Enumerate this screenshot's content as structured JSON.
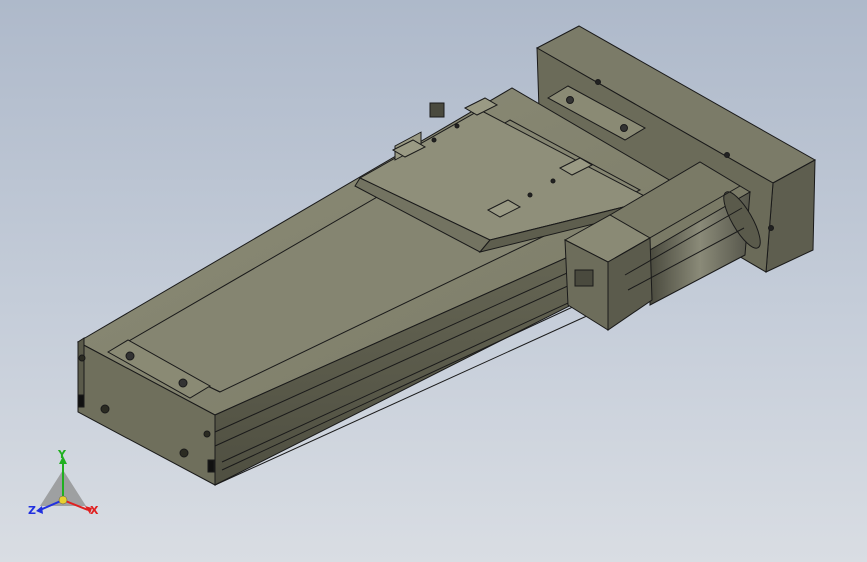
{
  "viewport": {
    "background_top": "#aeb9ca",
    "background_bottom": "#d9dde3",
    "model_color": "#6e6e5c",
    "edge_color": "#1a1a1a"
  },
  "triad": {
    "x_label": "X",
    "y_label": "Y",
    "z_label": "Z",
    "x_color": "#e02020",
    "y_color": "#20b020",
    "z_color": "#2030e0"
  }
}
